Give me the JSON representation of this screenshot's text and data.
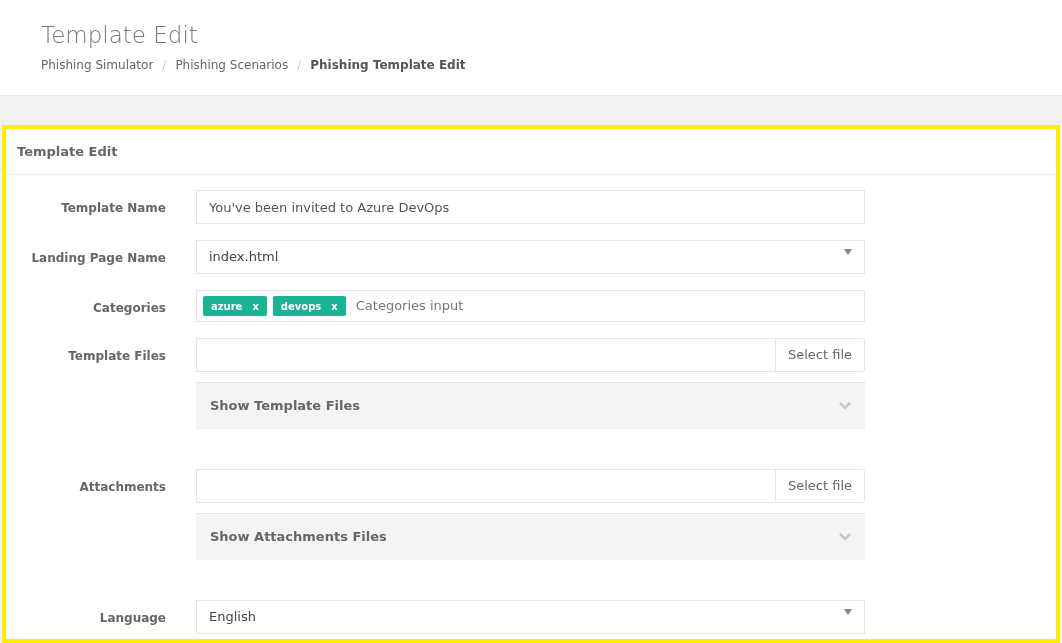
{
  "page_header": {
    "title": "Template Edit",
    "breadcrumb": [
      {
        "label": "Phishing Simulator",
        "current": false,
        "separator": "/"
      },
      {
        "label": "Phishing Scenarios",
        "current": false,
        "separator": "/"
      },
      {
        "label": "Phishing Template Edit",
        "current": true
      }
    ]
  },
  "panel": {
    "title": "Template Edit",
    "highlighted": true,
    "fields": [
      {
        "kind": "text",
        "label": "Template Name",
        "value": "You've been invited to Azure DevOps"
      },
      {
        "kind": "select",
        "label": "Landing Page Name",
        "value": "index.html"
      },
      {
        "kind": "tags",
        "label": "Categories",
        "tags": [
          {
            "label": "azure",
            "remove": "x"
          },
          {
            "label": "devops",
            "remove": "x"
          }
        ],
        "placeholder": "Categories input"
      },
      {
        "kind": "file",
        "label": "Template Files",
        "button": "Select file",
        "collapse": {
          "label": "Show Template Files",
          "expanded": false
        }
      },
      {
        "kind": "file",
        "label": "Attachments",
        "button": "Select file",
        "collapse": {
          "label": "Show Attachments Files",
          "expanded": false
        }
      },
      {
        "kind": "select",
        "label": "Language",
        "value": "English"
      }
    ]
  }
}
